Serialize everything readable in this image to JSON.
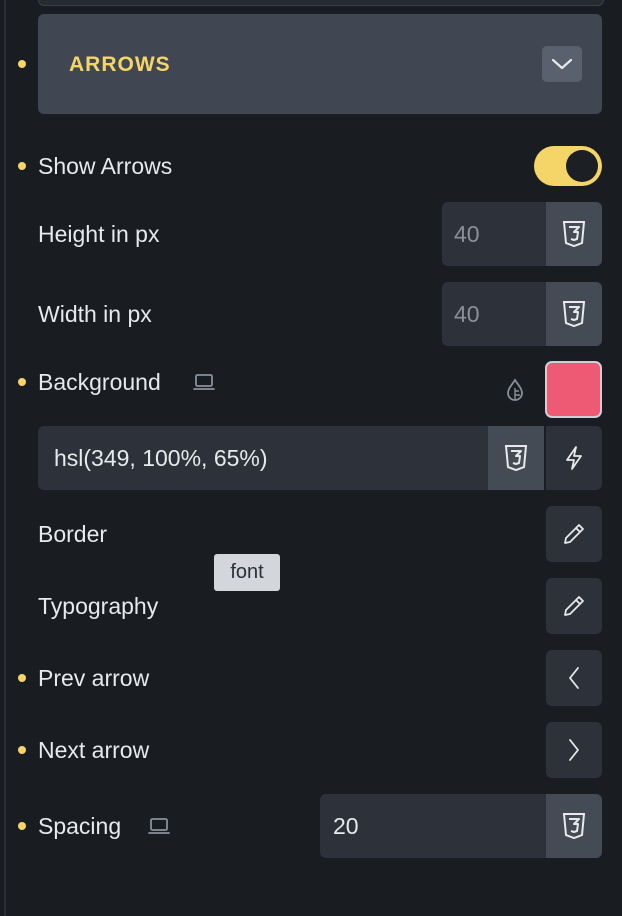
{
  "section": {
    "title": "ARROWS",
    "expand_icon": "chevron-down-icon"
  },
  "controls": {
    "show_arrows": {
      "label": "Show Arrows",
      "enabled": true
    },
    "height": {
      "label": "Height in px",
      "value": "40"
    },
    "width": {
      "label": "Width in px",
      "value": "40"
    },
    "background": {
      "label": "Background",
      "color_value": "hsl(349, 100%, 65%)",
      "swatch_color": "#ee5a73"
    },
    "border": {
      "label": "Border"
    },
    "typography": {
      "label": "Typography"
    },
    "prev_arrow": {
      "label": "Prev arrow"
    },
    "next_arrow": {
      "label": "Next arrow"
    },
    "spacing": {
      "label": "Spacing",
      "value": "20"
    }
  },
  "tooltip": {
    "text": "font"
  },
  "colors": {
    "accent": "#f6d568",
    "panel": "#191c20",
    "field": "#2d323a",
    "header": "#404752"
  },
  "icons": [
    "chevron-down-icon",
    "css3-icon",
    "laptop-icon",
    "drop-icon",
    "bolt-icon",
    "pencil-icon",
    "chevron-left-icon",
    "chevron-right-icon"
  ]
}
